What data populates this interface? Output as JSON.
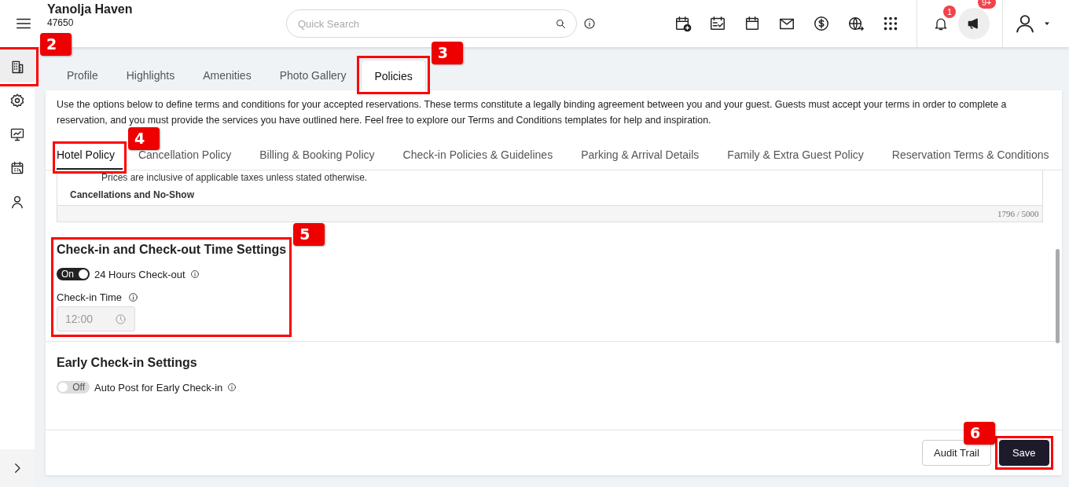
{
  "header": {
    "property_name": "Yanolja Haven",
    "property_id": "47650",
    "search": {
      "placeholder": "Quick Search"
    },
    "notifications": {
      "count": "1"
    },
    "announcements": {
      "count": "9+"
    }
  },
  "sidebar": {
    "items": [
      {
        "selected": true,
        "callout": "2"
      },
      {
        "selected": false
      },
      {
        "selected": false
      },
      {
        "selected": false
      },
      {
        "selected": false
      }
    ]
  },
  "tabs": [
    {
      "label": "Profile",
      "selected": false
    },
    {
      "label": "Highlights",
      "selected": false
    },
    {
      "label": "Amenities",
      "selected": false
    },
    {
      "label": "Photo Gallery",
      "selected": false
    },
    {
      "label": "Policies",
      "selected": true,
      "callout": "3"
    }
  ],
  "intro": "Use the options below to define terms and conditions for your accepted reservations. These terms constitute a legally binding agreement between you and your guest. Guests must accept your terms in order to complete a reservation, and you must provide the services you have outlined here. Feel free to explore our Terms and Conditions templates for help and inspiration.",
  "policy_tabs": [
    {
      "label": "Hotel Policy",
      "selected": true,
      "callout": "4"
    },
    {
      "label": "Cancellation Policy",
      "selected": false
    },
    {
      "label": "Billing & Booking Policy",
      "selected": false
    },
    {
      "label": "Check-in Policies & Guidelines",
      "selected": false
    },
    {
      "label": "Parking & Arrival Details",
      "selected": false
    },
    {
      "label": "Family & Extra Guest Policy",
      "selected": false
    },
    {
      "label": "Reservation Terms & Conditions",
      "selected": false
    }
  ],
  "editor": {
    "lines": [
      {
        "kind": "bullet",
        "text": "Prices are inclusive of applicable taxes unless stated otherwise."
      },
      {
        "kind": "heading",
        "text": "Cancellations and No-Show"
      }
    ],
    "counter": "1796 / 5000"
  },
  "sections": [
    {
      "title": "Check-in and Check-out Time Settings",
      "callout": "5",
      "toggles": [
        {
          "label": "24 Hours Check-out",
          "on": true,
          "state_text": "On"
        }
      ],
      "time_fields": [
        {
          "label": "Check-in Time",
          "value": "12:00",
          "disabled": true
        }
      ]
    },
    {
      "title": "Early Check-in Settings",
      "toggles": [
        {
          "label": "Auto Post for Early Check-in",
          "on": false,
          "state_text": "Off"
        }
      ]
    }
  ],
  "footer": {
    "buttons": [
      {
        "label": "Audit Trail",
        "kind": "secondary"
      },
      {
        "label": "Save",
        "kind": "primary",
        "callout": "6"
      }
    ]
  }
}
